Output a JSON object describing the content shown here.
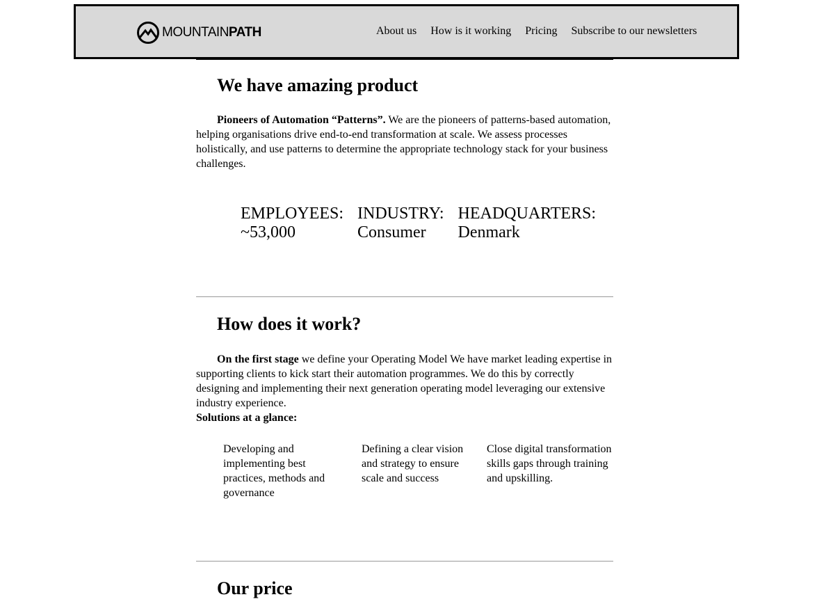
{
  "header": {
    "logo": {
      "icon": "mountain-logo-icon",
      "text_regular": "MOUNTAIN",
      "text_bold": "PATH"
    },
    "nav": [
      {
        "label": "About us"
      },
      {
        "label": "How is it working"
      },
      {
        "label": "Pricing"
      },
      {
        "label": "Subscribe to our newsletters"
      }
    ]
  },
  "product": {
    "title": "We have amazing product",
    "lead_bold": "Pioneers of Automation “Patterns”.",
    "lead_text": " We are the pioneers of patterns-based automation, helping organisations drive end-to-end transformation at scale. We assess processes holistically, and use patterns to determine the appropriate technology stack for your business challenges.",
    "stats": [
      {
        "label": "EMPLOYEES:",
        "value": "~53,000"
      },
      {
        "label": "INDUSTRY:",
        "value": "Consumer"
      },
      {
        "label": "HEADQUARTERS:",
        "value": "Denmark"
      }
    ]
  },
  "how": {
    "title": "How does it work?",
    "lead_bold": "On the first stage",
    "lead_text": " we define your Operating Model We have market leading expertise in supporting clients to kick start their automation programmes. We do this by correctly designing and implementing their next generation operating model leveraging our extensive industry experience.",
    "glance": "Solutions at a glance:",
    "solutions": [
      "Developing and implementing best practices, methods and governance",
      "Defining a clear vision and strategy to ensure scale and success",
      "Close digital transformation skills gaps through training and upskilling."
    ]
  },
  "price": {
    "title": "Our price"
  }
}
